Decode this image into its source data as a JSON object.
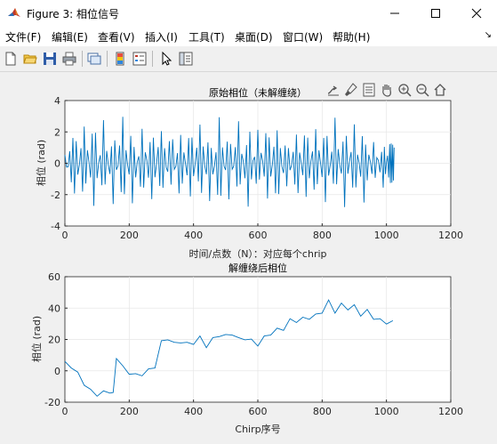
{
  "window": {
    "title": "Figure 3: 相位信号",
    "minimize": "—",
    "maximize": "☐",
    "close": "✕"
  },
  "menu": [
    "文件(F)",
    "编辑(E)",
    "查看(V)",
    "插入(I)",
    "工具(T)",
    "桌面(D)",
    "窗口(W)",
    "帮助(H)"
  ],
  "toolbar_icons": [
    "new-figure-icon",
    "open-file-icon",
    "save-icon",
    "print-icon",
    "link-plot-icon",
    "insert-colorbar-icon",
    "insert-legend-icon",
    "edit-plot-icon",
    "property-inspector-icon"
  ],
  "axes_toolbar_icons": [
    "export-icon",
    "brush-icon",
    "data-tips-icon",
    "pan-icon",
    "zoom-in-icon",
    "zoom-out-icon",
    "home-icon"
  ],
  "colors": {
    "line": "#0072bd",
    "axes_bg": "#ffffff",
    "figure_bg": "#f0f0f0",
    "grid": "#e6e6e6"
  },
  "chart_data": [
    {
      "type": "line",
      "title": "原始相位（未解缠绕）",
      "xlabel": "时间/点数（N）：对应每个chrip",
      "ylabel": "相位 (rad)",
      "xlim": [
        0,
        1200
      ],
      "ylim": [
        -4,
        4
      ],
      "xticks": [
        "0",
        "200",
        "400",
        "600",
        "800",
        "1000",
        "1200"
      ],
      "yticks": [
        "-4",
        "-2",
        "0",
        "2",
        "4"
      ],
      "grid": true,
      "x": [
        0,
        30,
        60,
        90,
        120,
        150,
        180,
        210,
        240,
        270,
        300,
        330,
        360,
        390,
        420,
        450,
        480,
        510,
        540,
        570,
        600,
        630,
        660,
        690,
        720,
        750,
        780,
        810,
        840,
        870,
        900,
        930,
        960,
        990,
        1010,
        1024
      ],
      "y": [
        0.8,
        -2.5,
        2.7,
        -2.9,
        2.8,
        -2.6,
        3.0,
        -2.7,
        2.5,
        -2.9,
        3.0,
        -2.4,
        2.8,
        -2.8,
        2.9,
        -2.6,
        3.0,
        -2.3,
        2.7,
        -2.9,
        2.4,
        -2.8,
        3.0,
        -2.5,
        2.9,
        -2.9,
        2.6,
        -2.7,
        3.0,
        -2.8,
        2.5,
        -2.6,
        1.5,
        -1.9,
        1.7,
        1.0
      ]
    },
    {
      "type": "line",
      "title": "解缠绕后相位",
      "xlabel": "Chirp序号",
      "ylabel": "相位 (rad)",
      "xlim": [
        0,
        1200
      ],
      "ylim": [
        -20,
        60
      ],
      "xticks": [
        "0",
        "200",
        "400",
        "600",
        "800",
        "1000",
        "1200"
      ],
      "yticks": [
        "-20",
        "0",
        "20",
        "40",
        "60"
      ],
      "grid": true,
      "x": [
        0,
        20,
        40,
        60,
        80,
        100,
        120,
        140,
        150,
        160,
        180,
        200,
        220,
        240,
        260,
        280,
        300,
        320,
        340,
        360,
        380,
        400,
        420,
        440,
        460,
        480,
        500,
        520,
        540,
        560,
        580,
        600,
        620,
        640,
        660,
        680,
        700,
        720,
        740,
        760,
        780,
        800,
        820,
        840,
        860,
        880,
        900,
        920,
        940,
        960,
        980,
        1000,
        1020
      ],
      "y": [
        6,
        3,
        -2,
        -8,
        -13,
        -15,
        -14,
        -13,
        -15,
        9,
        2,
        -1,
        -3,
        -2,
        0,
        3,
        18,
        21,
        17,
        19,
        17,
        18,
        21,
        16,
        20,
        23,
        22,
        24,
        20,
        21,
        19,
        17,
        21,
        24,
        26,
        27,
        32,
        32,
        33,
        34,
        35,
        38,
        44,
        38,
        42,
        40,
        41,
        36,
        38,
        34,
        32,
        31,
        32
      ]
    }
  ]
}
